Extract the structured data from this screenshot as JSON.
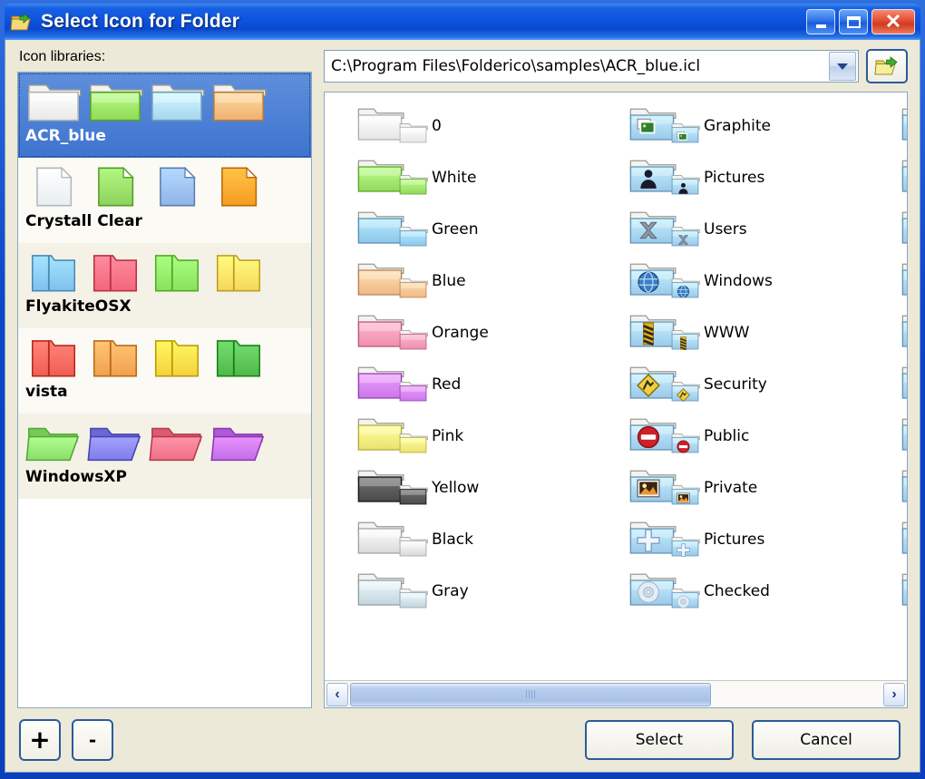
{
  "window": {
    "title": "Select Icon for Folder",
    "title_icon": "open-folder-arrow-icon",
    "minimize_label": "_",
    "maximize_label": "□",
    "close_label": "✕"
  },
  "left": {
    "label": "Icon libraries:",
    "libraries": [
      {
        "name": "ACR_blue",
        "selected": true,
        "swatches": [
          "#e9e9e9",
          "#8fd85a",
          "#a8d4ef",
          "#f0b273"
        ]
      },
      {
        "name": "Crystall Clear",
        "selected": false,
        "swatches": [
          "#e8eef2",
          "#8cd25c",
          "#8fb4e8",
          "#f59d22"
        ]
      },
      {
        "name": "FlyakiteOSX",
        "selected": false,
        "swatches": [
          "#7fc0ee",
          "#f2667a",
          "#87e25c",
          "#f6d65a"
        ]
      },
      {
        "name": "vista",
        "selected": false,
        "swatches": [
          "#ef5e53",
          "#f2a04e",
          "#f4d23c",
          "#4fb84a"
        ]
      },
      {
        "name": "WindowsXP",
        "selected": false,
        "swatches": [
          "#8ade6a",
          "#7e7ce8",
          "#ef6f85",
          "#c36de8"
        ]
      }
    ]
  },
  "path": {
    "value": "C:\\Program Files\\Folderico\\samples\\ACR_blue.icl",
    "dropdown_icon": "chevron-down-icon",
    "browse_icon": "open-folder-browse-icon"
  },
  "icons": {
    "columns": 3,
    "items": [
      {
        "label": "0",
        "color": "#e6e6e6",
        "col": 0,
        "emblem": null
      },
      {
        "label": "White",
        "color": "#93d95f",
        "col": 0,
        "emblem": null
      },
      {
        "label": "Green",
        "color": "#8fc6ea",
        "col": 0,
        "emblem": null
      },
      {
        "label": "Blue",
        "color": "#efb887",
        "col": 0,
        "emblem": null
      },
      {
        "label": "Orange",
        "color": "#ef8fab",
        "col": 0,
        "emblem": null
      },
      {
        "label": "Red",
        "color": "#c977e8",
        "col": 0,
        "emblem": null
      },
      {
        "label": "Pink",
        "color": "#e9e271",
        "col": 0,
        "emblem": null
      },
      {
        "label": "Yellow",
        "color": "#4a4a4a",
        "col": 0,
        "emblem": null
      },
      {
        "label": "Black",
        "color": "#d9d9d9",
        "col": 0,
        "emblem": null
      },
      {
        "label": "Gray",
        "color": "#c5d4dd",
        "col": 0,
        "emblem": null
      },
      {
        "label": "Graphite",
        "color": "#9cc9e9",
        "col": 1,
        "emblem": "photos-emblem"
      },
      {
        "label": "Pictures",
        "color": "#9cc9e9",
        "col": 1,
        "emblem": "person-emblem"
      },
      {
        "label": "Users",
        "color": "#9cc9e9",
        "col": 1,
        "emblem": "x-emblem"
      },
      {
        "label": "Windows",
        "color": "#9cc9e9",
        "col": 1,
        "emblem": "globe-emblem"
      },
      {
        "label": "WWW",
        "color": "#9cc9e9",
        "col": 1,
        "emblem": "zip-emblem"
      },
      {
        "label": "Security",
        "color": "#9cc9e9",
        "col": 1,
        "emblem": "warning-diamond-emblem"
      },
      {
        "label": "Public",
        "color": "#9cc9e9",
        "col": 1,
        "emblem": "no-entry-emblem"
      },
      {
        "label": "Private",
        "color": "#9cc9e9",
        "col": 1,
        "emblem": "picture-frame-emblem"
      },
      {
        "label": "Pictures",
        "color": "#9cc9e9",
        "col": 1,
        "emblem": "plus-emblem"
      },
      {
        "label": "Checked",
        "color": "#9cc9e9",
        "col": 1,
        "emblem": "disc-emblem"
      },
      {
        "label": "",
        "color": "#9cc9e9",
        "col": 2,
        "emblem": null
      },
      {
        "label": "",
        "color": "#9cc9e9",
        "col": 2,
        "emblem": null
      },
      {
        "label": "",
        "color": "#9cc9e9",
        "col": 2,
        "emblem": null
      },
      {
        "label": "",
        "color": "#9cc9e9",
        "col": 2,
        "emblem": null
      },
      {
        "label": "",
        "color": "#9cc9e9",
        "col": 2,
        "emblem": null
      },
      {
        "label": "",
        "color": "#9cc9e9",
        "col": 2,
        "emblem": null
      },
      {
        "label": "",
        "color": "#9cc9e9",
        "col": 2,
        "emblem": null
      },
      {
        "label": "",
        "color": "#9cc9e9",
        "col": 2,
        "emblem": null
      },
      {
        "label": "",
        "color": "#9cc9e9",
        "col": 2,
        "emblem": null
      },
      {
        "label": "",
        "color": "#9cc9e9",
        "col": 2,
        "emblem": null
      }
    ]
  },
  "hscrollbar": {
    "left_arrow": "‹",
    "right_arrow": "›",
    "thumb_percent": 68
  },
  "buttons": {
    "add_label": "+",
    "remove_label": "-",
    "select_label": "Select",
    "cancel_label": "Cancel"
  },
  "colors": {
    "titlebar_blue": "#0c52dd",
    "frame_blue": "#0a46c8",
    "client_bg": "#ece9d8",
    "selection_blue": "#3f74cf",
    "button_border": "#2b5a9b"
  }
}
